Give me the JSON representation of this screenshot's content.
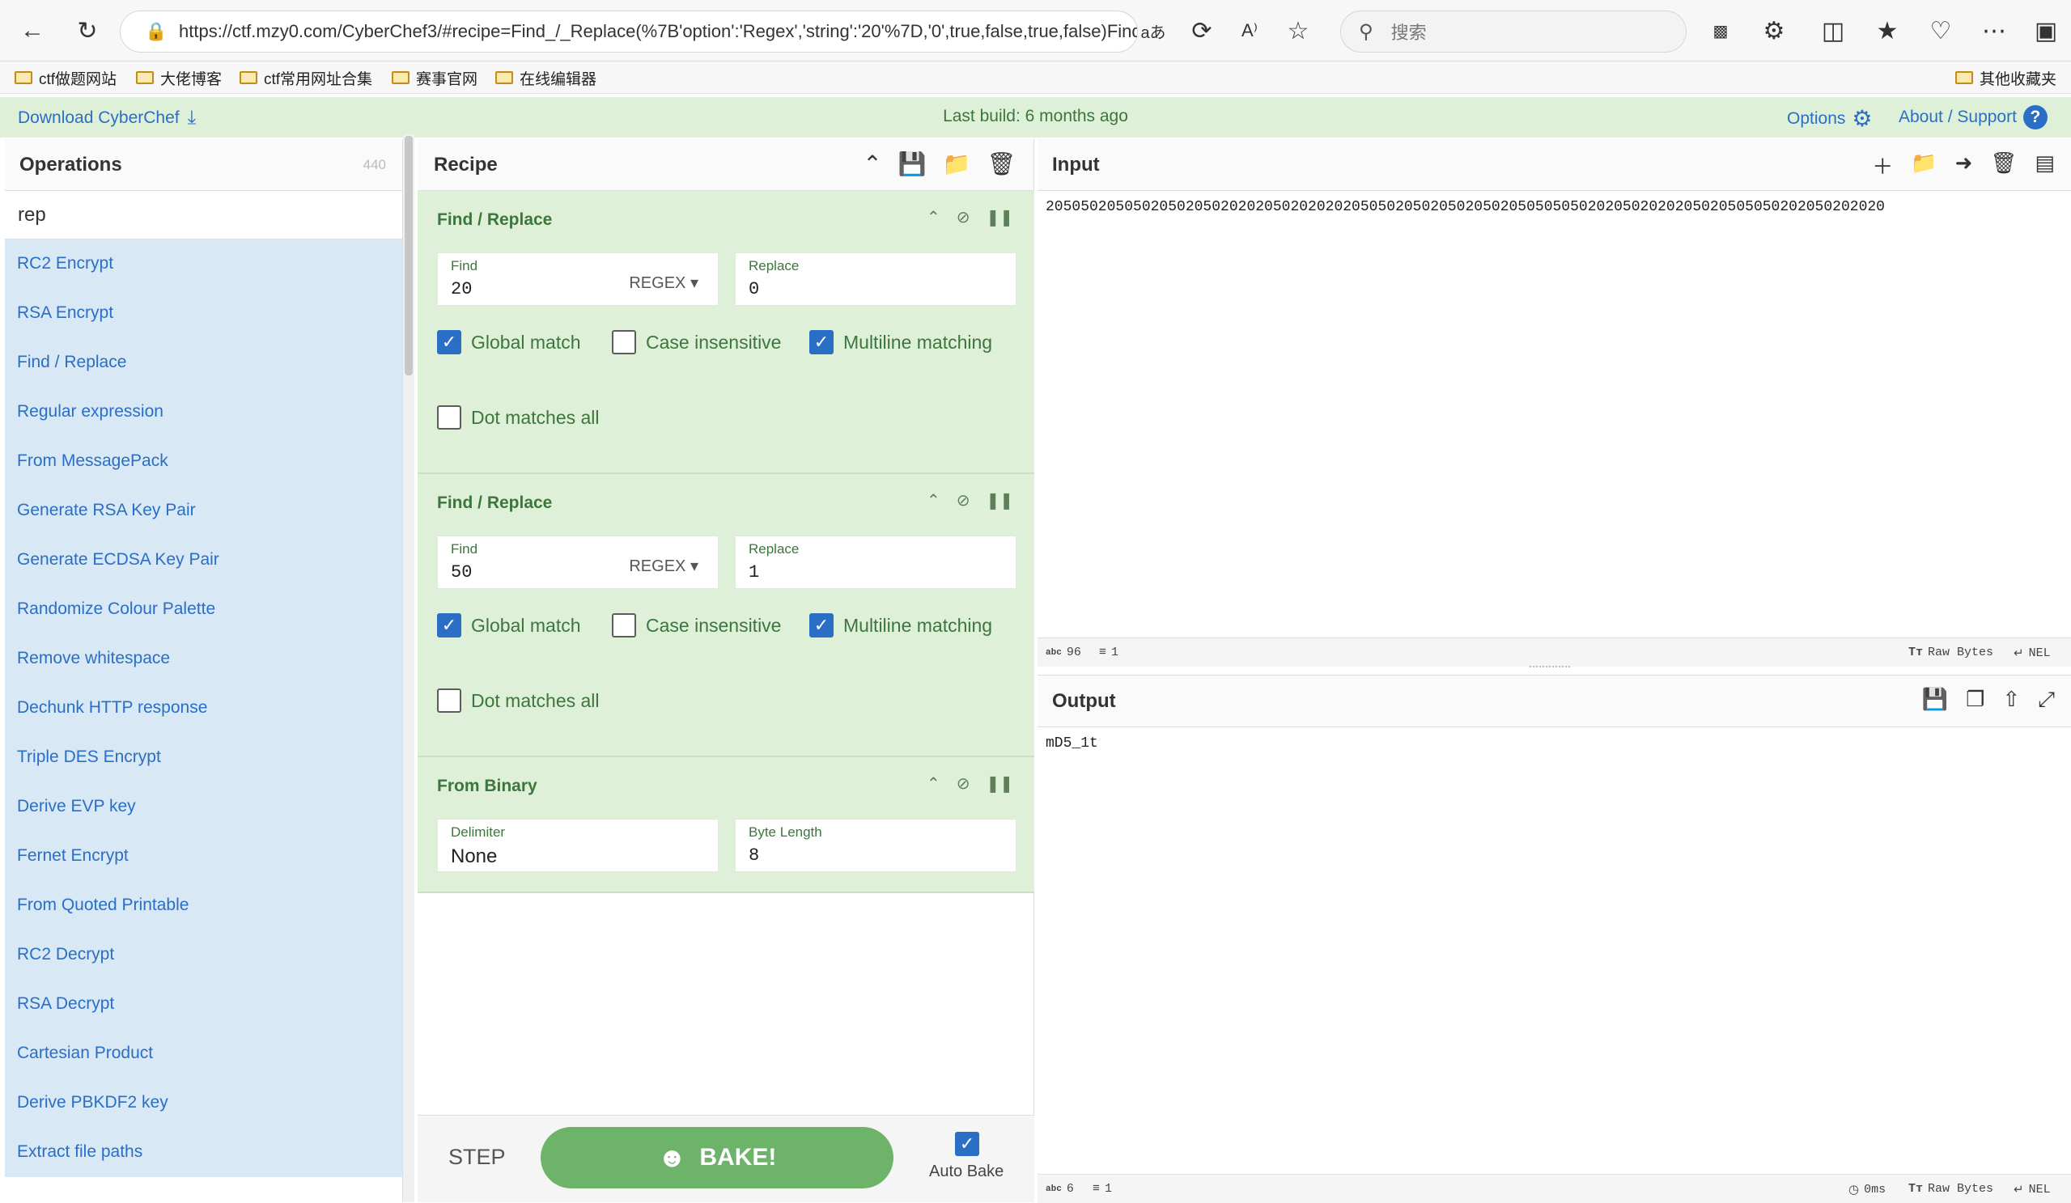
{
  "browser": {
    "url": "https://ctf.mzy0.com/CyberChef3/#recipe=Find_/_Replace(%7B'option':'Regex','string':'20'%7D,'0',true,false,true,false)Find_/_...",
    "search_placeholder": "搜索",
    "translate_glyph": "aあ",
    "read_aloud_glyph": "A⁾",
    "bookmarks": [
      "ctf做题网站",
      "大佬博客",
      "ctf常用网址合集",
      "赛事官网",
      "在线编辑器"
    ],
    "other_bookmarks": "其他收藏夹"
  },
  "banner": {
    "download": "Download CyberChef",
    "last_build": "Last build: 6 months ago",
    "options": "Options",
    "about": "About / Support"
  },
  "operations": {
    "title": "Operations",
    "count": "440",
    "search_value": "rep",
    "items": [
      "RC2 Encrypt",
      "RSA Encrypt",
      "Find / Replace",
      "Regular expression",
      "From MessagePack",
      "Generate RSA Key Pair",
      "Generate ECDSA Key Pair",
      "Randomize Colour Palette",
      "Remove whitespace",
      "Dechunk HTTP response",
      "Triple DES Encrypt",
      "Derive EVP key",
      "Fernet Encrypt",
      "From Quoted Printable",
      "RC2 Decrypt",
      "RSA Decrypt",
      "Cartesian Product",
      "Derive PBKDF2 key",
      "Extract file paths"
    ]
  },
  "recipe": {
    "title": "Recipe",
    "ops": [
      {
        "name": "Find / Replace",
        "find_label": "Find",
        "find_value": "20",
        "find_mode": "REGEX",
        "replace_label": "Replace",
        "replace_value": "0",
        "global_match": "Global match",
        "case_insensitive": "Case insensitive",
        "multiline": "Multiline matching",
        "dot_all": "Dot matches all"
      },
      {
        "name": "Find / Replace",
        "find_label": "Find",
        "find_value": "50",
        "find_mode": "REGEX",
        "replace_label": "Replace",
        "replace_value": "1",
        "global_match": "Global match",
        "case_insensitive": "Case insensitive",
        "multiline": "Multiline matching",
        "dot_all": "Dot matches all"
      },
      {
        "name": "From Binary",
        "delimiter_label": "Delimiter",
        "delimiter_value": "None",
        "byte_length_label": "Byte Length",
        "byte_length_value": "8"
      }
    ],
    "step": "STEP",
    "bake": "BAKE!",
    "auto_bake": "Auto Bake"
  },
  "input": {
    "title": "Input",
    "text": "205050205050205020502020205020202020505020502050205020505050502020502020205020505050202050202020",
    "status": {
      "chars": "96",
      "lines": "1",
      "enc_label": "Raw Bytes",
      "eol": "NEL"
    }
  },
  "output": {
    "title": "Output",
    "text": "mD5_1t",
    "status": {
      "chars": "6",
      "lines": "1",
      "time": "0ms",
      "enc_label": "Raw Bytes",
      "eol": "NEL"
    }
  }
}
